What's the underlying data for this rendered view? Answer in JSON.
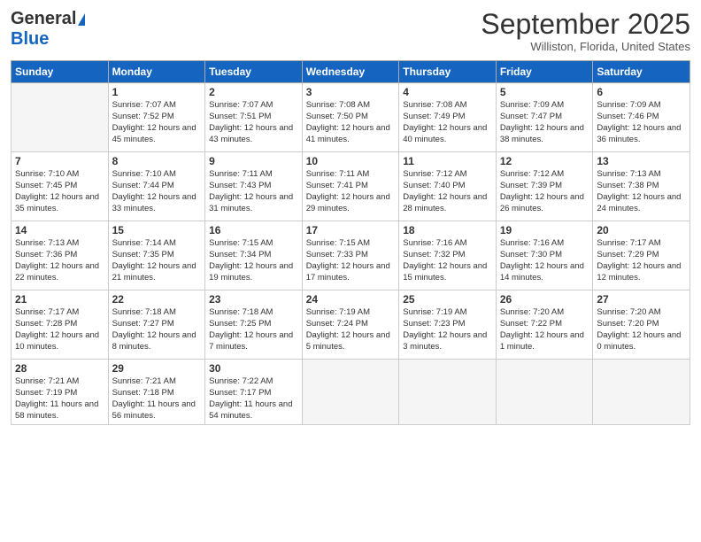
{
  "header": {
    "logo_line1": "General",
    "logo_line2": "Blue",
    "month_title": "September 2025",
    "location": "Williston, Florida, United States"
  },
  "days_of_week": [
    "Sunday",
    "Monday",
    "Tuesday",
    "Wednesday",
    "Thursday",
    "Friday",
    "Saturday"
  ],
  "weeks": [
    [
      {
        "day": "",
        "empty": true
      },
      {
        "day": "1",
        "sunrise": "Sunrise: 7:07 AM",
        "sunset": "Sunset: 7:52 PM",
        "daylight": "Daylight: 12 hours and 45 minutes."
      },
      {
        "day": "2",
        "sunrise": "Sunrise: 7:07 AM",
        "sunset": "Sunset: 7:51 PM",
        "daylight": "Daylight: 12 hours and 43 minutes."
      },
      {
        "day": "3",
        "sunrise": "Sunrise: 7:08 AM",
        "sunset": "Sunset: 7:50 PM",
        "daylight": "Daylight: 12 hours and 41 minutes."
      },
      {
        "day": "4",
        "sunrise": "Sunrise: 7:08 AM",
        "sunset": "Sunset: 7:49 PM",
        "daylight": "Daylight: 12 hours and 40 minutes."
      },
      {
        "day": "5",
        "sunrise": "Sunrise: 7:09 AM",
        "sunset": "Sunset: 7:47 PM",
        "daylight": "Daylight: 12 hours and 38 minutes."
      },
      {
        "day": "6",
        "sunrise": "Sunrise: 7:09 AM",
        "sunset": "Sunset: 7:46 PM",
        "daylight": "Daylight: 12 hours and 36 minutes."
      }
    ],
    [
      {
        "day": "7",
        "sunrise": "Sunrise: 7:10 AM",
        "sunset": "Sunset: 7:45 PM",
        "daylight": "Daylight: 12 hours and 35 minutes."
      },
      {
        "day": "8",
        "sunrise": "Sunrise: 7:10 AM",
        "sunset": "Sunset: 7:44 PM",
        "daylight": "Daylight: 12 hours and 33 minutes."
      },
      {
        "day": "9",
        "sunrise": "Sunrise: 7:11 AM",
        "sunset": "Sunset: 7:43 PM",
        "daylight": "Daylight: 12 hours and 31 minutes."
      },
      {
        "day": "10",
        "sunrise": "Sunrise: 7:11 AM",
        "sunset": "Sunset: 7:41 PM",
        "daylight": "Daylight: 12 hours and 29 minutes."
      },
      {
        "day": "11",
        "sunrise": "Sunrise: 7:12 AM",
        "sunset": "Sunset: 7:40 PM",
        "daylight": "Daylight: 12 hours and 28 minutes."
      },
      {
        "day": "12",
        "sunrise": "Sunrise: 7:12 AM",
        "sunset": "Sunset: 7:39 PM",
        "daylight": "Daylight: 12 hours and 26 minutes."
      },
      {
        "day": "13",
        "sunrise": "Sunrise: 7:13 AM",
        "sunset": "Sunset: 7:38 PM",
        "daylight": "Daylight: 12 hours and 24 minutes."
      }
    ],
    [
      {
        "day": "14",
        "sunrise": "Sunrise: 7:13 AM",
        "sunset": "Sunset: 7:36 PM",
        "daylight": "Daylight: 12 hours and 22 minutes."
      },
      {
        "day": "15",
        "sunrise": "Sunrise: 7:14 AM",
        "sunset": "Sunset: 7:35 PM",
        "daylight": "Daylight: 12 hours and 21 minutes."
      },
      {
        "day": "16",
        "sunrise": "Sunrise: 7:15 AM",
        "sunset": "Sunset: 7:34 PM",
        "daylight": "Daylight: 12 hours and 19 minutes."
      },
      {
        "day": "17",
        "sunrise": "Sunrise: 7:15 AM",
        "sunset": "Sunset: 7:33 PM",
        "daylight": "Daylight: 12 hours and 17 minutes."
      },
      {
        "day": "18",
        "sunrise": "Sunrise: 7:16 AM",
        "sunset": "Sunset: 7:32 PM",
        "daylight": "Daylight: 12 hours and 15 minutes."
      },
      {
        "day": "19",
        "sunrise": "Sunrise: 7:16 AM",
        "sunset": "Sunset: 7:30 PM",
        "daylight": "Daylight: 12 hours and 14 minutes."
      },
      {
        "day": "20",
        "sunrise": "Sunrise: 7:17 AM",
        "sunset": "Sunset: 7:29 PM",
        "daylight": "Daylight: 12 hours and 12 minutes."
      }
    ],
    [
      {
        "day": "21",
        "sunrise": "Sunrise: 7:17 AM",
        "sunset": "Sunset: 7:28 PM",
        "daylight": "Daylight: 12 hours and 10 minutes."
      },
      {
        "day": "22",
        "sunrise": "Sunrise: 7:18 AM",
        "sunset": "Sunset: 7:27 PM",
        "daylight": "Daylight: 12 hours and 8 minutes."
      },
      {
        "day": "23",
        "sunrise": "Sunrise: 7:18 AM",
        "sunset": "Sunset: 7:25 PM",
        "daylight": "Daylight: 12 hours and 7 minutes."
      },
      {
        "day": "24",
        "sunrise": "Sunrise: 7:19 AM",
        "sunset": "Sunset: 7:24 PM",
        "daylight": "Daylight: 12 hours and 5 minutes."
      },
      {
        "day": "25",
        "sunrise": "Sunrise: 7:19 AM",
        "sunset": "Sunset: 7:23 PM",
        "daylight": "Daylight: 12 hours and 3 minutes."
      },
      {
        "day": "26",
        "sunrise": "Sunrise: 7:20 AM",
        "sunset": "Sunset: 7:22 PM",
        "daylight": "Daylight: 12 hours and 1 minute."
      },
      {
        "day": "27",
        "sunrise": "Sunrise: 7:20 AM",
        "sunset": "Sunset: 7:20 PM",
        "daylight": "Daylight: 12 hours and 0 minutes."
      }
    ],
    [
      {
        "day": "28",
        "sunrise": "Sunrise: 7:21 AM",
        "sunset": "Sunset: 7:19 PM",
        "daylight": "Daylight: 11 hours and 58 minutes."
      },
      {
        "day": "29",
        "sunrise": "Sunrise: 7:21 AM",
        "sunset": "Sunset: 7:18 PM",
        "daylight": "Daylight: 11 hours and 56 minutes."
      },
      {
        "day": "30",
        "sunrise": "Sunrise: 7:22 AM",
        "sunset": "Sunset: 7:17 PM",
        "daylight": "Daylight: 11 hours and 54 minutes."
      },
      {
        "day": "",
        "empty": true
      },
      {
        "day": "",
        "empty": true
      },
      {
        "day": "",
        "empty": true
      },
      {
        "day": "",
        "empty": true
      }
    ]
  ]
}
